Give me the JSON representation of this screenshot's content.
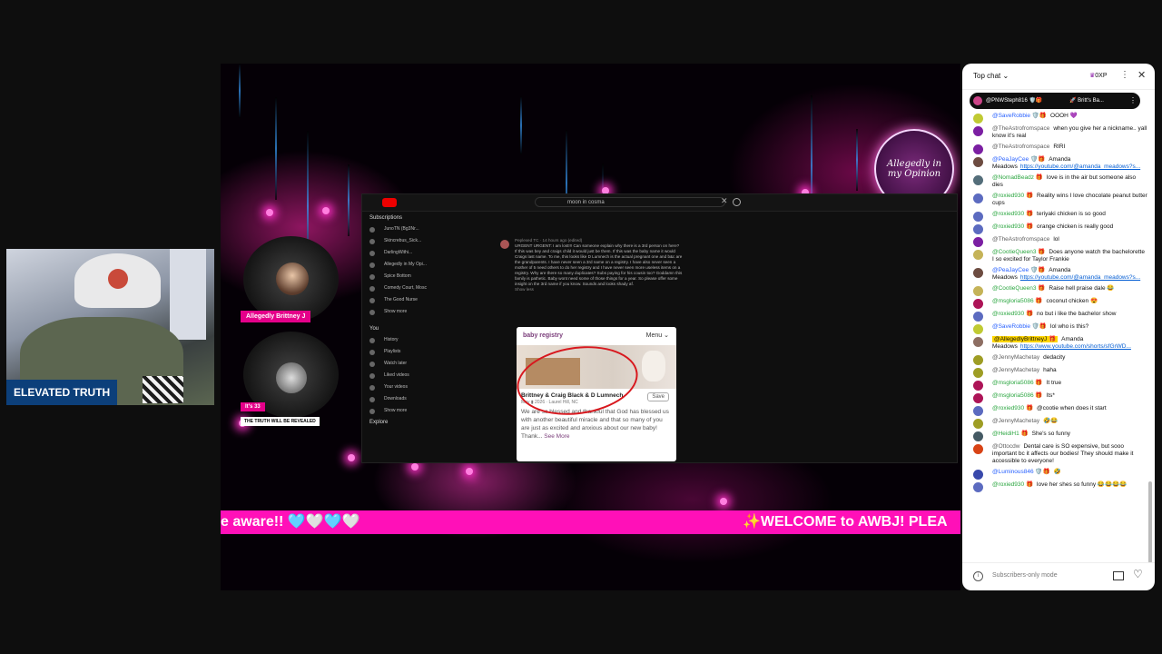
{
  "webcam": {
    "label": "ELEVATED TRUTH"
  },
  "stream": {
    "logo_text": "Allegedly in my Opinion",
    "host_tag": "Allegedly Brittney J",
    "guest_tag": "It's ​​​​​​​​​​​​​​​​​​​​​​​​​​​​​​​​​​​​33",
    "guest_sub": "THE TRUTH WILL BE REVEALED",
    "ticker_left": "e aware!! 🩵🤍🩵🤍",
    "ticker_right": "✨WELCOME to AWBJ! PLEA",
    "inner": {
      "search_text": "moon in cosma",
      "sidebar_heading": "Subscriptions",
      "sidebar_items": [
        "JunoTN (Bg3Nr...",
        "Skincrebus_Sick...",
        "DarlingWithi...",
        "Allegedly in My Opi...",
        "Spice Bottom",
        "Comedy Court, Mosc",
        "The Good Nurse",
        "Show more"
      ],
      "you_heading": "You",
      "you_items": [
        "History",
        "Playlists",
        "Watch later",
        "Liked videos",
        "Your videos",
        "Downloads",
        "Show more"
      ],
      "explore": "Explore",
      "comment_author": "Peplexed TC · 14 hours ago (edited)",
      "comment_text": "URGENT URGENT: I am lost!!! Can someone explain why there is a 3rd person on here? If this was bey and craigs child it would just be them. If this was the baby name it would Craigs last name. To me, this looks like D Lumnech is the actual pregnant one and b&c are the grandparents. I have never seen a 3rd name on a registry. I have also never seen a mother of 5 need others to do her registry and I have never seen more useless items on a registry. Why are there so many duplicates? Subs paying for his cousin too? Goddamn this family is pathetic. Baby wont need some of those things for a year. So please offer some insight on the 3rd name if you know. Sounds and looks shady af.",
      "show_less": "Show less",
      "card_title": "baby registry",
      "card_menu": "Menu ⌄",
      "card_names": "Brittney & Craig Black & D Lumnech",
      "card_date": "May ▮ 2026 · Laurel Hill, NC",
      "card_save": "Save",
      "card_body": "We are so blessed and thankful that God has blessed us with another beautiful miracle and that so many of you are just as excited and anxious about our new baby! Thank...",
      "card_see_more": "See More"
    }
  },
  "chat": {
    "mode": "Top chat",
    "xp": "0XP",
    "pinned_user": "@PNWSteph816 🛡️🎁",
    "pinned_text": "🚀 Britt's Ba...",
    "footer_placeholder": "Subscribers-only mode",
    "messages": [
      {
        "author": "@SaveRobbie 🛡️🎁",
        "text": "OOOH 💜",
        "color": "#c0ca33",
        "style": "blue"
      },
      {
        "author": "@TheAstrofromspace",
        "text": "when you give her a nickname.. yall know it's real",
        "color": "#7b1fa2",
        "style": ""
      },
      {
        "author": "@TheAstrofromspace",
        "text": "RIRI",
        "color": "#7b1fa2",
        "style": ""
      },
      {
        "author": "@PeaJayCee 🛡️🎁",
        "text": "Amanda Meadows",
        "link": "https://youtube.com/@amanda_meadows?s...",
        "color": "#6d4c41",
        "style": "blue"
      },
      {
        "author": "@NomadBeadz 🎁",
        "text": "love is in the air but someone also dies",
        "color": "#546e7a",
        "style": "green"
      },
      {
        "author": "@roxied930 🎁",
        "text": "Reality wins I love chocolate peanut butter cups",
        "color": "#5c6bc0",
        "style": "green"
      },
      {
        "author": "@roxied930 🎁",
        "text": "teriyaki chicken is so good",
        "color": "#5c6bc0",
        "style": "green"
      },
      {
        "author": "@roxied930 🎁",
        "text": "orange chicken is really good",
        "color": "#5c6bc0",
        "style": "green"
      },
      {
        "author": "@TheAstrofromspace",
        "text": "lol",
        "color": "#7b1fa2",
        "style": ""
      },
      {
        "author": "@CootieQueen3 🎁",
        "text": "Does anyone watch the bachelorette I so excited for Taylor Frankie",
        "color": "#c5b358",
        "style": "green"
      },
      {
        "author": "@PeaJayCee 🛡️🎁",
        "text": "Amanda Meadows",
        "link": "https://youtube.com/@amanda_meadows?s...",
        "color": "#6d4c41",
        "style": "blue"
      },
      {
        "author": "@CootieQueen3 🎁",
        "text": "Raise hell praise dale 😂",
        "color": "#c5b358",
        "style": "green"
      },
      {
        "author": "@msgloria5086 🎁",
        "text": "coconut chicken 😍",
        "color": "#ad1457",
        "style": "green"
      },
      {
        "author": "@roxied930 🎁",
        "text": "no but i like the bachelor show",
        "color": "#5c6bc0",
        "style": "green"
      },
      {
        "author": "@SaveRobbie 🛡️🎁",
        "text": "lol who is this?",
        "color": "#c0ca33",
        "style": "blue"
      },
      {
        "author": "@AllegedlyBrittneyJ 🎁",
        "text": "Amanda Meadows",
        "link": "https://www.youtube.com/shorts/sfGrWD...",
        "color": "#8d6e63",
        "style": "hl"
      },
      {
        "author": "@JennyMachetay",
        "text": "dedacity",
        "color": "#9e9d24",
        "style": ""
      },
      {
        "author": "@JennyMachetay",
        "text": "haha",
        "color": "#9e9d24",
        "style": ""
      },
      {
        "author": "@msgloria5086 🎁",
        "text": "It true",
        "color": "#ad1457",
        "style": "green"
      },
      {
        "author": "@msgloria5086 🎁",
        "text": "Its*",
        "color": "#ad1457",
        "style": "green"
      },
      {
        "author": "@roxied930 🎁",
        "text": "@cootie when does it start",
        "color": "#5c6bc0",
        "style": "green"
      },
      {
        "author": "@JennyMachetay",
        "text": "🤣😂",
        "color": "#9e9d24",
        "style": ""
      },
      {
        "author": "@HeidiH1 🎁",
        "text": "She's so funny",
        "color": "#455a64",
        "style": "green"
      },
      {
        "author": "@Ottocdw",
        "text": "Dental care is SO expensive, but sooo important bc it affects our bodies! They should make it accessible to everyone!",
        "color": "#d84315",
        "style": ""
      },
      {
        "author": "@Luminous846 🛡️🎁",
        "text": "🤣",
        "color": "#3949ab",
        "style": "blue"
      },
      {
        "author": "@roxied930 🎁",
        "text": "love her shes so funny 😂😂😂😂",
        "color": "#5c6bc0",
        "style": "green"
      }
    ]
  }
}
